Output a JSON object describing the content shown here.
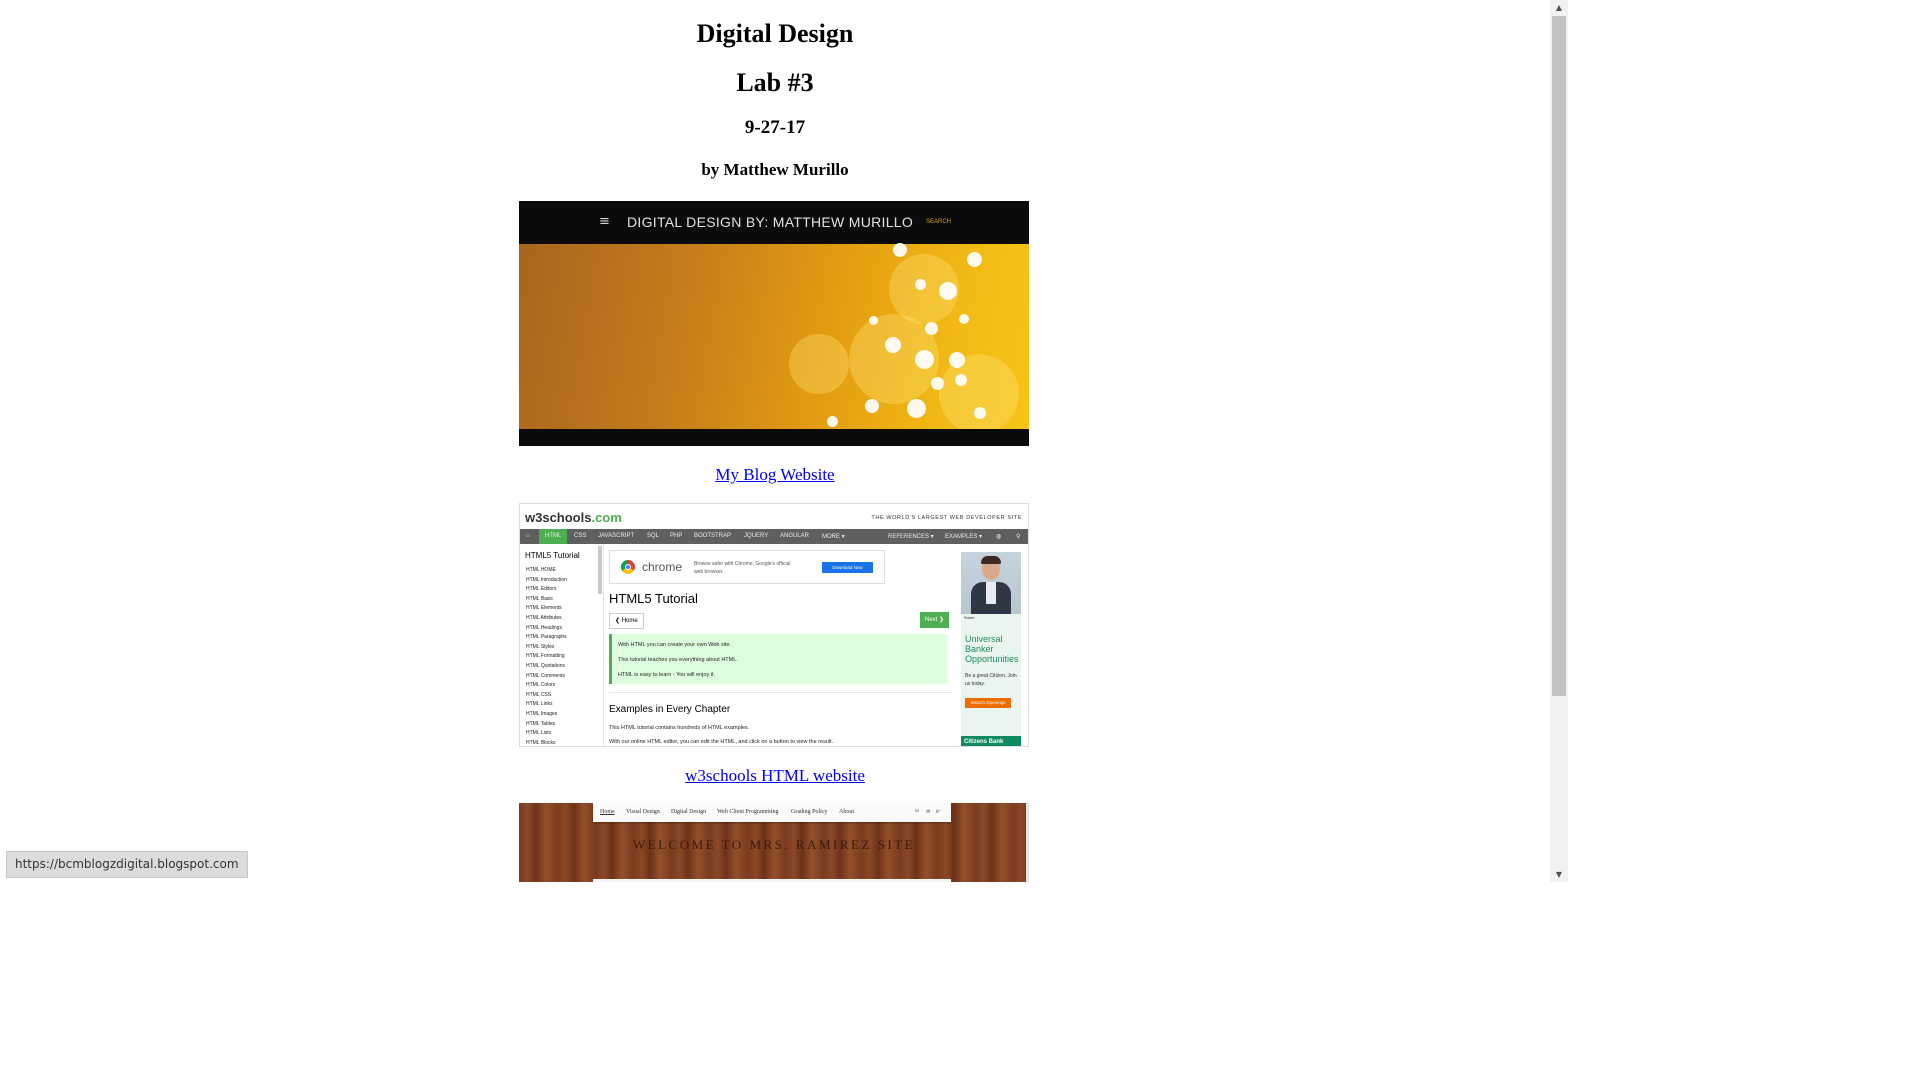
{
  "heading": {
    "title": "Digital Design",
    "lab": "Lab #3",
    "date": "9-27-17",
    "author": "by Matthew Murillo"
  },
  "blog_shot": {
    "menu_icon": "≡",
    "site_title": "DIGITAL DESIGN BY: MATTHEW MURILLO",
    "search": "SEARCH",
    "accent": "#e0a020"
  },
  "links": {
    "blog": "My Blog Website",
    "w3schools": "w3schools HTML website"
  },
  "w3_shot": {
    "logo_main": "w3schools",
    "logo_tld": ".com",
    "tagline": "THE WORLD'S LARGEST WEB DEVELOPER SITE",
    "nav": [
      "HTML",
      "CSS",
      "JAVASCRIPT",
      "SQL",
      "PHP",
      "BOOTSTRAP",
      "JQUERY",
      "ANGULAR",
      "MORE ▾"
    ],
    "nav_right": [
      "REFERENCES ▾",
      "EXAMPLES ▾"
    ],
    "sidebar_heading": "HTML5 Tutorial",
    "sidebar_items": [
      "HTML HOME",
      "HTML Introduction",
      "HTML Editors",
      "HTML Basic",
      "HTML Elements",
      "HTML Attributes",
      "HTML Headings",
      "HTML Paragraphs",
      "HTML Styles",
      "HTML Formatting",
      "HTML Quotations",
      "HTML Comments",
      "HTML Colors",
      "HTML CSS",
      "HTML Links",
      "HTML Images",
      "HTML Tables",
      "HTML Lists",
      "HTML Blocks"
    ],
    "ad_chrome_word": "chrome",
    "ad_chrome_text": "Browse safer with Chrome, Google's official web browser.",
    "ad_chrome_button": "Download Now",
    "page_title": "HTML5 Tutorial",
    "home_button": "❮ Home",
    "next_button": "Next ❯",
    "note_lines": [
      "With HTML you can create your own Web site.",
      "This tutorial teaches you everything about HTML.",
      "HTML is easy to learn - You will enjoy it."
    ],
    "section_title": "Examples in Every Chapter",
    "section_p1": "This HTML tutorial contains hundreds of HTML examples.",
    "section_p2": "With our online HTML editor, you can edit the HTML, and click on a button to view the result.",
    "side_ad": {
      "name": "Robert",
      "headline": "Universal Banker Opportunities",
      "body": "Be a great Citizen. Join us today.",
      "button": "Search Openings",
      "brand": "Citizens Bank"
    },
    "accent": "#4caf50"
  },
  "ramirez_shot": {
    "nav": [
      "Home",
      "Visual Design",
      "Digital Design",
      "Web Client Programming",
      "Grading Policy",
      "About"
    ],
    "social": [
      "in",
      "✉",
      "8⁺"
    ],
    "title": "WELCOME TO MRS. RAMIREZ SITE"
  },
  "status_url": "https://bcmblogzdigital.blogspot.com",
  "scrollbar": {
    "up": "▲",
    "down": "▼"
  }
}
